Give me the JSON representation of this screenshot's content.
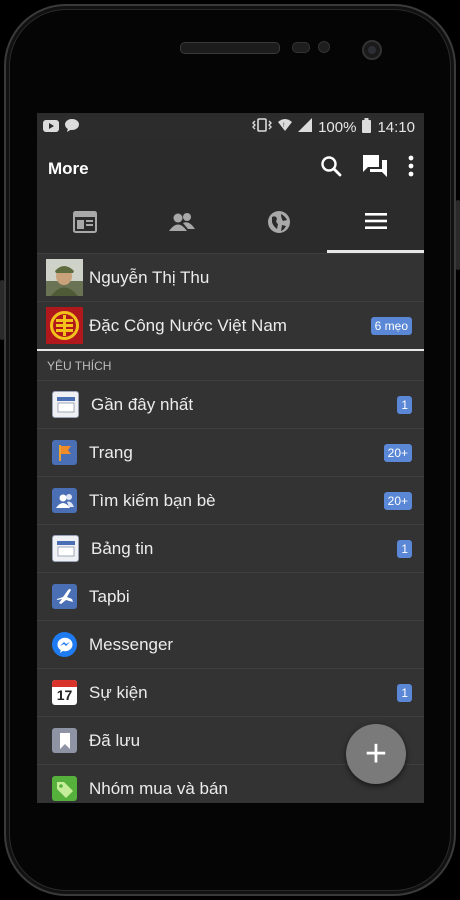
{
  "status_bar": {
    "left_icons": [
      "youtube-icon",
      "chat-bubble-icon"
    ],
    "right_icons": [
      "vibrate-icon",
      "wifi-icon",
      "signal-icon"
    ],
    "battery": "100%",
    "time": "14:10"
  },
  "app_bar": {
    "title": "More",
    "actions": [
      "search-icon",
      "messenger-icon",
      "overflow-menu-icon"
    ]
  },
  "tabs": [
    {
      "icon": "news-feed-icon",
      "active": false
    },
    {
      "icon": "friends-icon",
      "active": false
    },
    {
      "icon": "globe-icon",
      "active": false
    },
    {
      "icon": "menu-icon",
      "active": true
    }
  ],
  "profiles": [
    {
      "name": "Nguyễn Thị Thu",
      "badge": ""
    },
    {
      "name": "Đặc Công Nước Việt Nam",
      "badge": "6 mẹo"
    }
  ],
  "favorites": {
    "heading": "YÊU THÍCH",
    "items": [
      {
        "label": "Gần đây nhất",
        "badge": "1",
        "icon": "recent-feed-icon"
      },
      {
        "label": "Trang",
        "badge": "20+",
        "icon": "pages-flag-icon"
      },
      {
        "label": "Tìm kiếm bạn bè",
        "badge": "20+",
        "icon": "find-friends-icon"
      },
      {
        "label": "Bảng tin",
        "badge": "1",
        "icon": "news-feed-icon"
      },
      {
        "label": "Tapbi",
        "badge": "",
        "icon": "airplane-icon"
      },
      {
        "label": "Messenger",
        "badge": "",
        "icon": "messenger-app-icon"
      },
      {
        "label": "Sự kiện",
        "badge": "1",
        "icon": "calendar-icon"
      },
      {
        "label": "Đã lưu",
        "badge": "",
        "icon": "bookmark-icon"
      },
      {
        "label": "Nhóm mua và bán",
        "badge": "",
        "icon": "price-tag-icon"
      }
    ]
  },
  "calendar_day": "17",
  "fab": {
    "icon": "plus-icon",
    "label": "+"
  },
  "colors": {
    "badge": "#5a87d6",
    "screen_bg": "#2b2b2b",
    "list_bg": "#333333"
  }
}
